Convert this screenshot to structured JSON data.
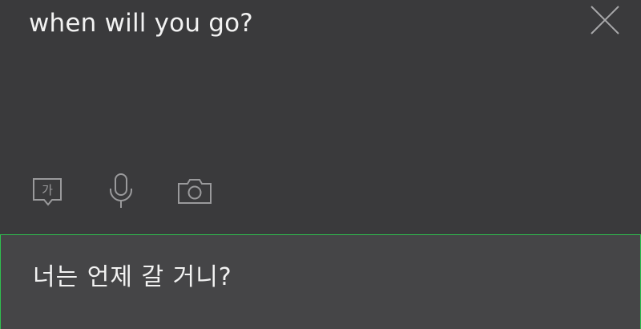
{
  "source": {
    "text": "when will you go?"
  },
  "toolbar": {
    "handwriting_glyph": "가",
    "icons": [
      "handwriting-icon",
      "microphone-icon",
      "camera-icon"
    ]
  },
  "close": {
    "icon": "close-icon"
  },
  "result": {
    "text": "너는 언제 갈 거니?"
  },
  "colors": {
    "background": "#3a3a3c",
    "result_background": "#454547",
    "accent_border": "#2fbf4f",
    "text": "#f2f2f2",
    "icon": "#9a9a9c"
  }
}
